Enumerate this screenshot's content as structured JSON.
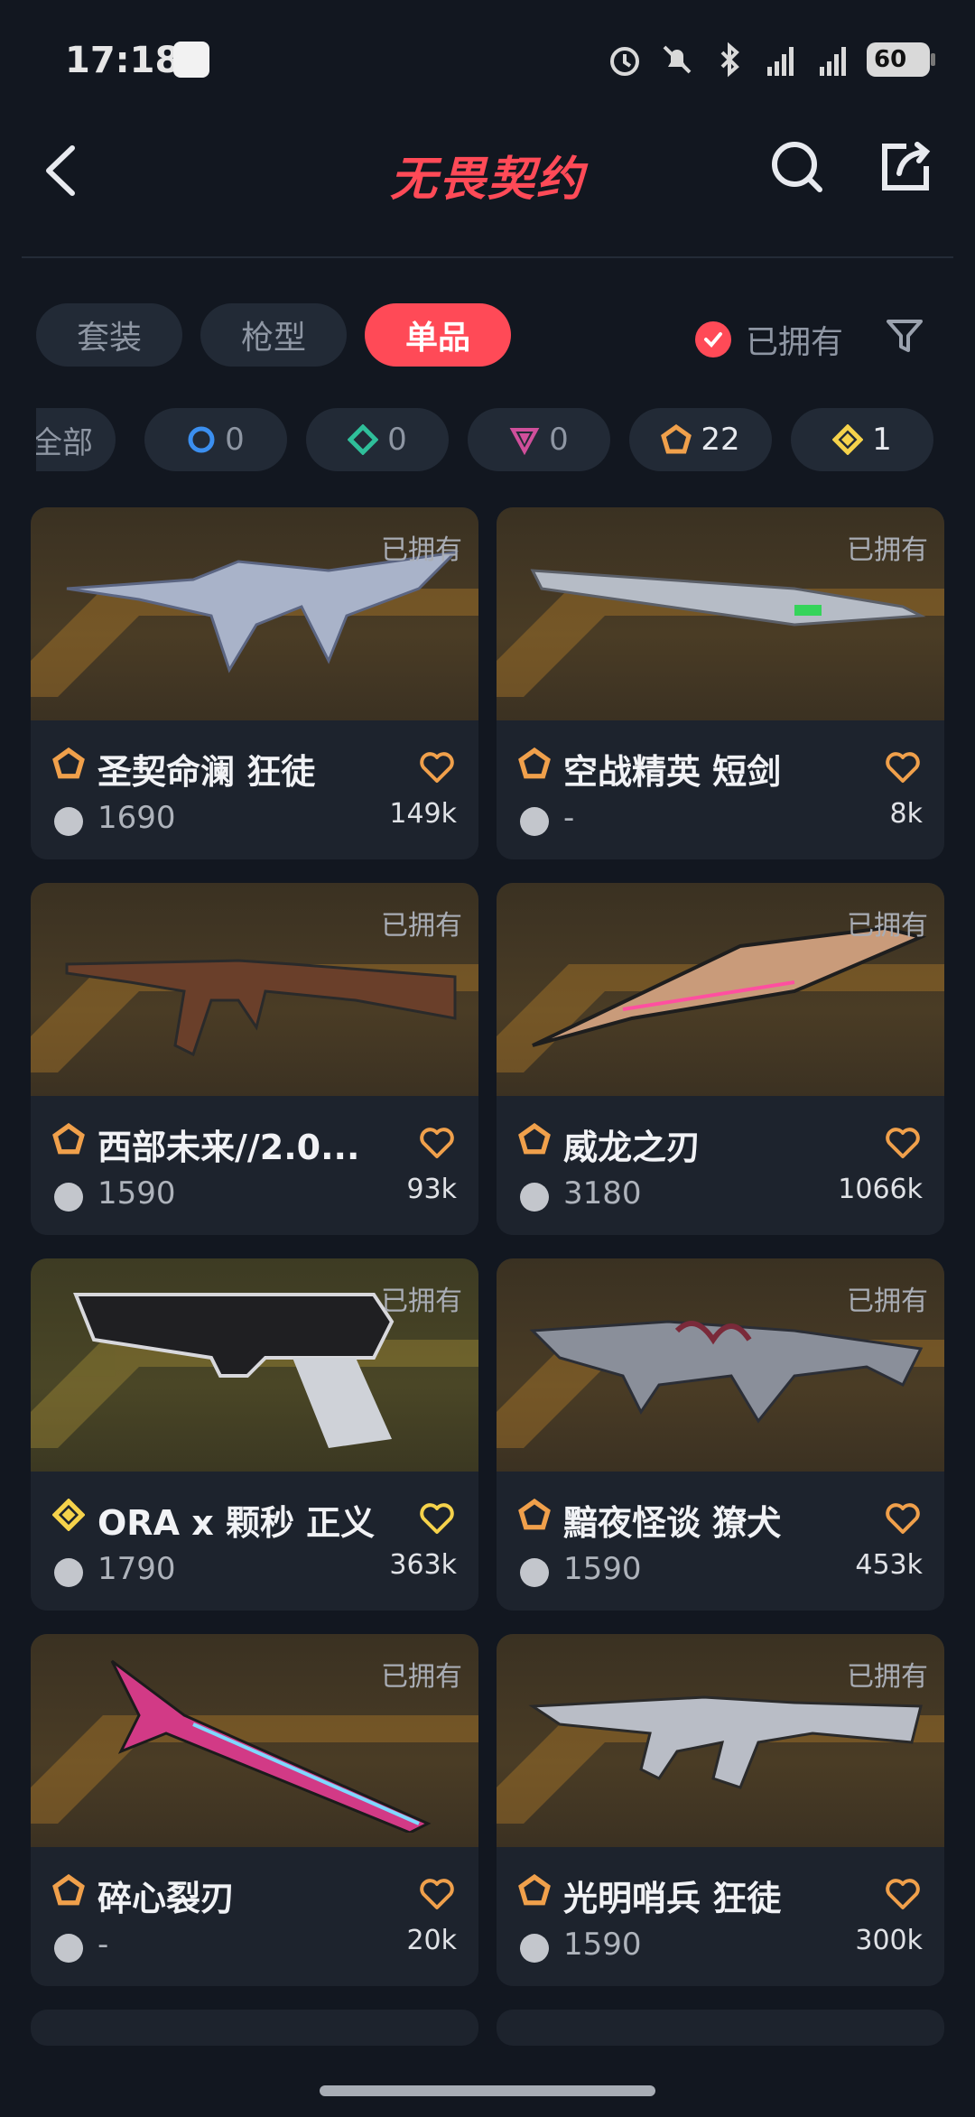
{
  "status_bar": {
    "time": "17:18",
    "battery": "60"
  },
  "header": {
    "title": "无畏契约"
  },
  "tabs": [
    {
      "label": "套装",
      "active": false
    },
    {
      "label": "枪型",
      "active": false
    },
    {
      "label": "单品",
      "active": true
    }
  ],
  "owned_filter": {
    "label": "已拥有",
    "checked": true
  },
  "chips": [
    {
      "label": "全部"
    },
    {
      "icon": "blue-circle-tier-icon",
      "value": "0",
      "color": "#3b8ff0"
    },
    {
      "icon": "green-diamond-tier-icon",
      "value": "0",
      "color": "#2fbf9a"
    },
    {
      "icon": "pink-triangle-tier-icon",
      "value": "0",
      "color": "#d04f9b"
    },
    {
      "icon": "orange-pentagon-tier-icon",
      "value": "22",
      "color": "#f0a04b"
    },
    {
      "icon": "yellow-diamond-tier-icon",
      "value": "1",
      "color": "#f5d24b"
    }
  ],
  "cards": [
    {
      "owned": "已拥有",
      "tier": "exclusive",
      "name": "圣契命澜 狂徒",
      "price": "1690",
      "likes": "149k"
    },
    {
      "owned": "已拥有",
      "tier": "exclusive",
      "name": "空战精英 短剑",
      "price": "-",
      "likes": "8k"
    },
    {
      "owned": "已拥有",
      "tier": "exclusive",
      "name": "西部未来//2.0...",
      "price": "1590",
      "likes": "93k"
    },
    {
      "owned": "已拥有",
      "tier": "exclusive",
      "name": "威龙之刃",
      "price": "3180",
      "likes": "1066k"
    },
    {
      "owned": "已拥有",
      "tier": "ultra",
      "name": "ORA x 颗秒 正义",
      "price": "1790",
      "likes": "363k"
    },
    {
      "owned": "已拥有",
      "tier": "exclusive",
      "name": "黯夜怪谈 獠犬",
      "price": "1590",
      "likes": "453k"
    },
    {
      "owned": "已拥有",
      "tier": "exclusive",
      "name": "碎心裂刃",
      "price": "-",
      "likes": "20k"
    },
    {
      "owned": "已拥有",
      "tier": "exclusive",
      "name": "光明哨兵 狂徒",
      "price": "1590",
      "likes": "300k"
    }
  ],
  "colors": {
    "accent": "#ff4a57",
    "exclusive_tier": "#f0a04b",
    "ultra_tier": "#f5d24b",
    "heart": "#f0a04b"
  }
}
